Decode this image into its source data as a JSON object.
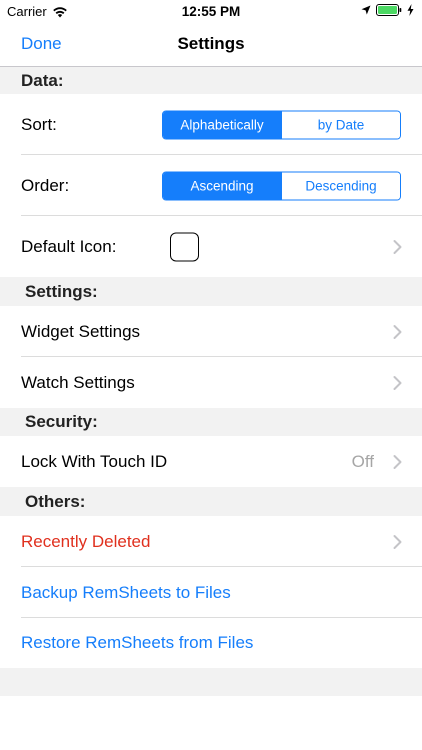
{
  "status_bar": {
    "carrier": "Carrier",
    "time": "12:55 PM"
  },
  "nav": {
    "done_label": "Done",
    "title": "Settings"
  },
  "sections": {
    "data": {
      "header": "Data:",
      "sort_label": "Sort:",
      "sort_options": [
        "Alphabetically",
        "by Date"
      ],
      "sort_selected": "Alphabetically",
      "order_label": "Order:",
      "order_options": [
        "Ascending",
        "Descending"
      ],
      "order_selected": "Ascending",
      "default_icon_label": "Default Icon:"
    },
    "settings": {
      "header": "Settings:",
      "widget_label": "Widget Settings",
      "watch_label": "Watch Settings"
    },
    "security": {
      "header": "Security:",
      "lock_label": "Lock With Touch ID",
      "lock_value": "Off"
    },
    "others": {
      "header": "Others:",
      "recently_deleted_label": "Recently Deleted",
      "backup_label": "Backup RemSheets to Files",
      "restore_label": "Restore RemSheets from Files"
    }
  },
  "colors": {
    "accent": "#157efb",
    "destructive": "#e0301e",
    "battery": "#4cd964"
  }
}
